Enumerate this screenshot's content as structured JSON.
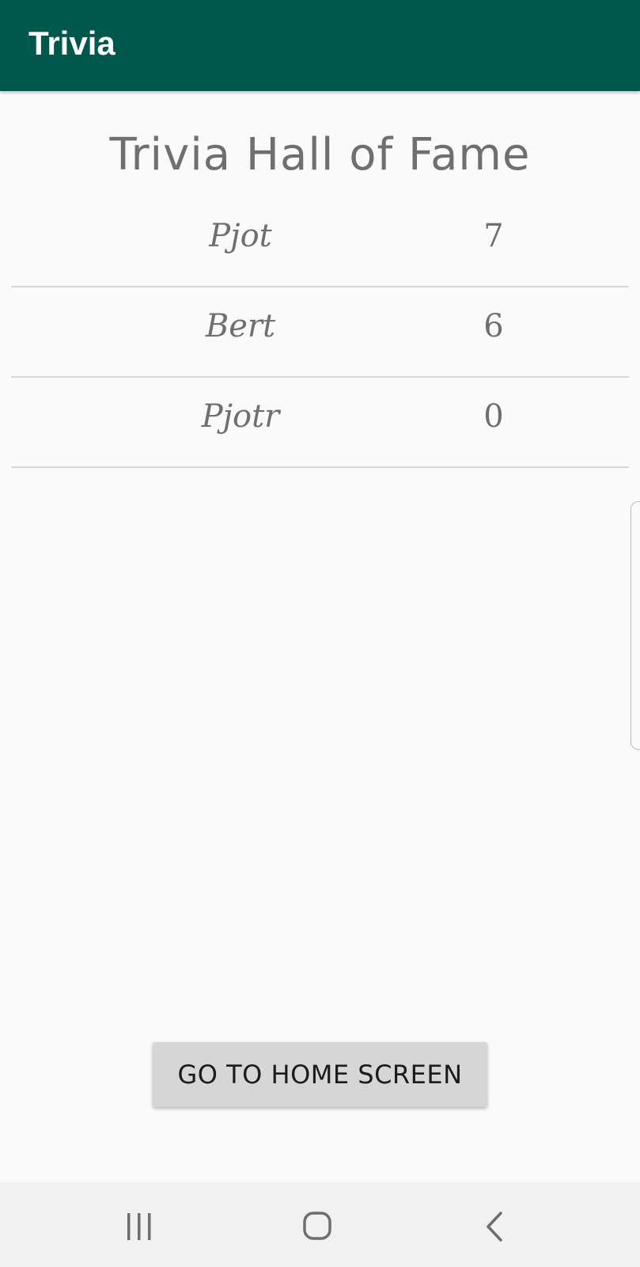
{
  "app_bar": {
    "title": "Trivia",
    "color": "#00574b"
  },
  "page": {
    "title": "Trivia Hall of Fame"
  },
  "scores": [
    {
      "name": "Pjot",
      "score": "7"
    },
    {
      "name": "Bert",
      "score": "6"
    },
    {
      "name": "Pjotr",
      "score": "0"
    }
  ],
  "actions": {
    "home_label": "GO TO HOME SCREEN"
  },
  "nav": {
    "recents_icon": "recents-icon",
    "home_icon": "home-icon",
    "back_icon": "back-icon"
  }
}
